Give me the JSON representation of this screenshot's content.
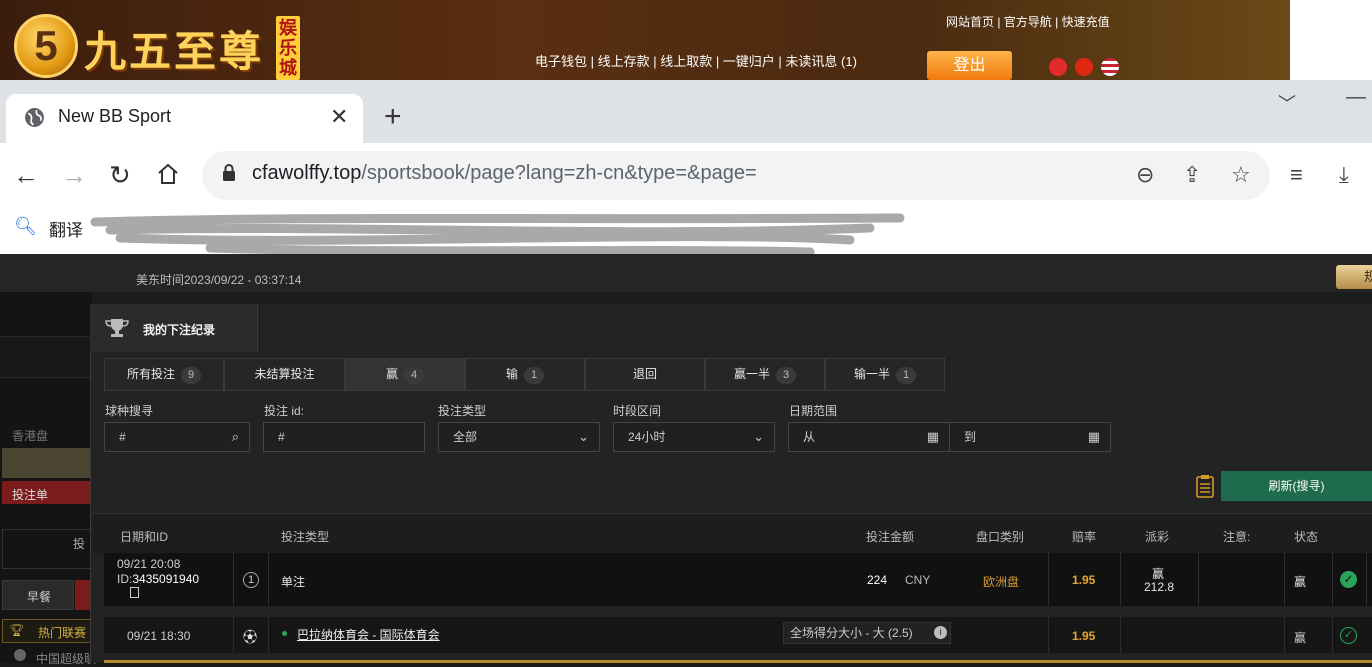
{
  "site_header": {
    "logo_mark": "5",
    "logo_text": "九五至尊",
    "logo_badge": "娱乐城",
    "top_links": "网站首页 | 官方导航 | 快速充值",
    "wallet_links": "电子钱包  |  线上存款  |  线上取款  |  一键归户  |  未读讯息 (1)",
    "login_label": "登出"
  },
  "browser": {
    "tab_title": "New BB Sport",
    "url_host": "cfawolffy.top",
    "url_path": "/sportsbook/page?lang=zh-cn&type=&page=",
    "bookmark_translate": "翻译"
  },
  "page": {
    "time_text": "美东时间2023/09/22 - 03:37:14",
    "rule_btn": "规",
    "sidebar": {
      "hk_odds": "香港盘",
      "bet_slip": "投注单",
      "bet_label": "投",
      "early": "早餐",
      "hot_league": "热门联赛",
      "cn_super": "中国超级联"
    }
  },
  "panel": {
    "title": "我的下注纪录",
    "tabs": [
      {
        "label": "所有投注",
        "count": "9"
      },
      {
        "label": "未结算投注",
        "count": ""
      },
      {
        "label": "赢",
        "count": "4"
      },
      {
        "label": "输",
        "count": "1"
      },
      {
        "label": "退回",
        "count": ""
      },
      {
        "label": "赢一半",
        "count": "3"
      },
      {
        "label": "输一半",
        "count": "1"
      }
    ],
    "filters": {
      "sport_label": "球种搜寻",
      "sport_placeholder": "#",
      "betid_label": "投注 id:",
      "betid_placeholder": "#",
      "bettype_label": "投注类型",
      "bettype_value": "全部",
      "period_label": "时段区间",
      "period_value": "24小时",
      "daterange_label": "日期范围",
      "from_placeholder": "从",
      "to_placeholder": "到"
    },
    "refresh_label": "刷新(搜寻)",
    "columns": [
      "日期和ID",
      "投注类型",
      "投注金额",
      "盘口类别",
      "赔率",
      "派彩",
      "注意:",
      "状态"
    ],
    "row1": {
      "date": "09/21 20:08",
      "id_prefix": "ID:",
      "id": "3435091940",
      "num": "1",
      "type": "单注",
      "amount": "224",
      "currency": "CNY",
      "market": "欧洲盘",
      "odds": "1.95",
      "payout_status": "赢",
      "payout": "212.8",
      "status": "赢"
    },
    "row2": {
      "date": "09/21 18:30",
      "match": "巴拉纳体育会 - 国际体育会",
      "market_detail": "全场得分大小 - 大 (2.5)",
      "odds": "1.95",
      "status": "赢"
    }
  }
}
